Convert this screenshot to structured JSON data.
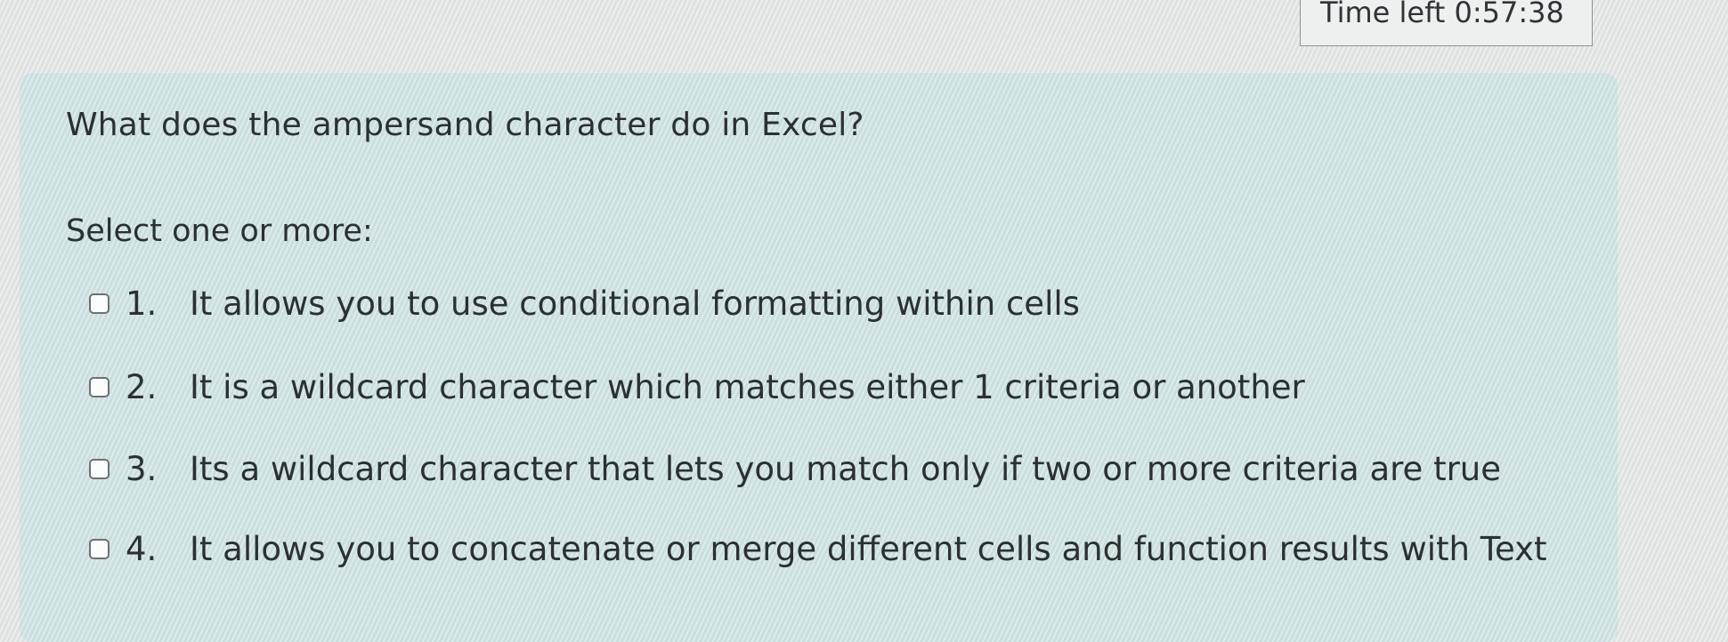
{
  "timer": {
    "text": "Time left 0:57:38"
  },
  "question": {
    "text": "What does the ampersand character do in Excel?",
    "prompt": "Select one or more:",
    "answers": [
      {
        "number": "1.",
        "label": "It allows you to use conditional formatting within cells",
        "checked": false
      },
      {
        "number": "2.",
        "label": "It is a wildcard character which matches either 1 criteria or another",
        "checked": false
      },
      {
        "number": "3.",
        "label": "Its a wildcard character that lets you match only if two or more criteria are true",
        "checked": false
      },
      {
        "number": "4.",
        "label": "It allows you to concatenate or merge different cells and function results with Text",
        "checked": false
      }
    ]
  }
}
